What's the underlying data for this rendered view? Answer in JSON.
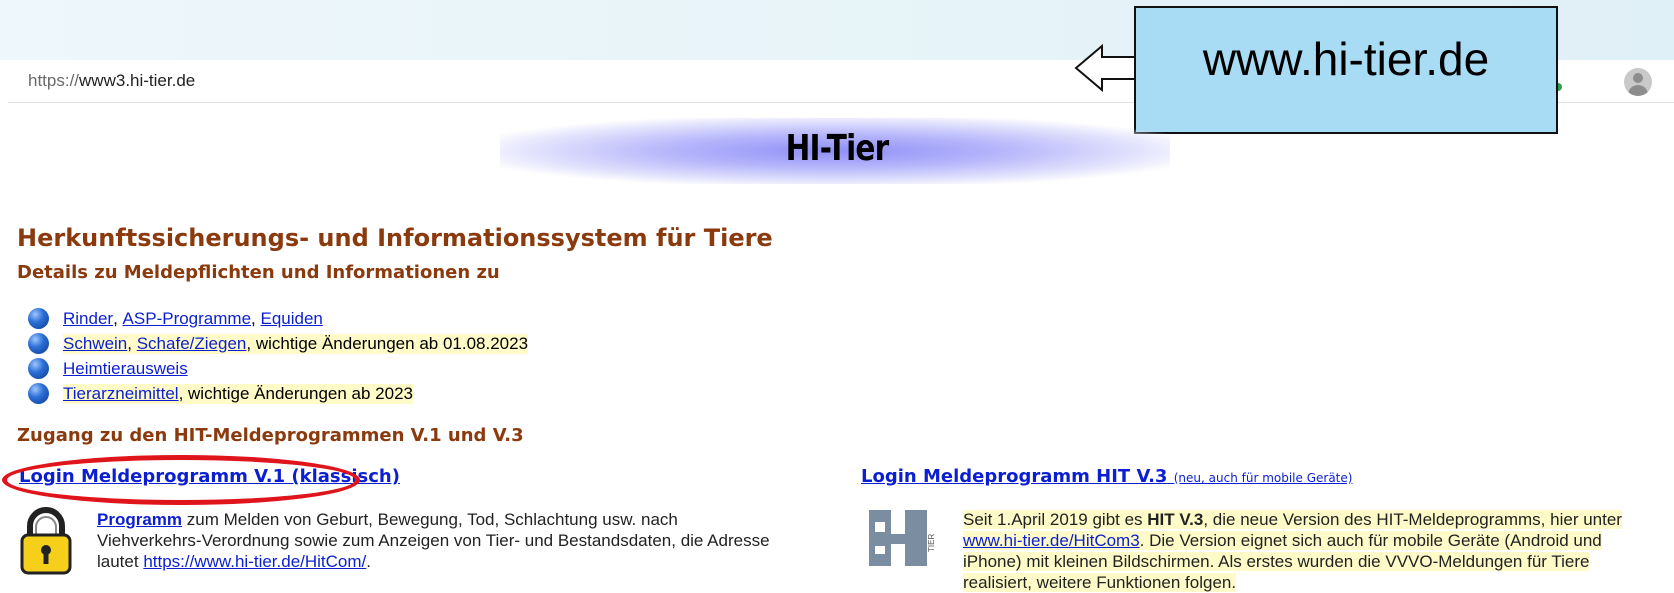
{
  "browser": {
    "url_scheme": "https://",
    "url_host": "www3.hi-tier.de",
    "extension_icon": "heart-monitor-icon",
    "profile_icon": "avatar-icon"
  },
  "callout": {
    "text": "www.hi-tier.de",
    "color": "#a8dcf5"
  },
  "banner": {
    "title": "HI-Tier"
  },
  "heading": "Herkunftssicherungs- und Informationssystem für Tiere",
  "details_heading": "Details zu Meldepflichten und Informationen zu",
  "list": [
    {
      "links": [
        "Rinder",
        "ASP-Programme",
        "Equiden"
      ],
      "note": ""
    },
    {
      "links": [
        "Schwein",
        "Schafe/Ziegen"
      ],
      "note": "wichtige Änderungen ab 01.08.2023"
    },
    {
      "links": [
        "Heimtierausweis"
      ],
      "note": ""
    },
    {
      "links": [
        "Tierarzneimittel"
      ],
      "note": "wichtige Änderungen ab 2023"
    }
  ],
  "access_heading": "Zugang zu den HIT-Meldeprogrammen V.1 und V.3",
  "login_v1": {
    "label": "Login Meldeprogramm V.1 (klassisch)",
    "desc_link": "Programm",
    "desc_line1": " zum Melden von Geburt, Bewegung, Tod, Schlachtung usw. nach",
    "desc_line2": "Viehverkehrs-Verordnung sowie zum Anzeigen von Tier- und Bestandsdaten, die Adresse",
    "desc_line3_prefix": "lautet ",
    "desc_url": "https://www.hi-tier.de/HitCom/",
    "desc_line3_suffix": "."
  },
  "login_v3": {
    "label": "Login Meldeprogramm HIT V.3",
    "small": "(neu, auch für mobile Geräte)",
    "desc_prefix": "Seit 1.April 2019 gibt es ",
    "desc_bold": "HIT V.3",
    "desc_line1_suffix": ", die neue Version des HIT-Meldeprogramms, hier unter",
    "desc_url": "www.hi-tier.de/HitCom3",
    "desc_line2_suffix": ". Die Version eignet sich auch für mobile Geräte (Android und",
    "desc_line3": "iPhone) mit kleinen Bildschirmen. Als erstes wurden die VVVO-Meldungen für Tiere",
    "desc_line4": "realisiert, weitere Funktionen folgen.",
    "logo_text": "TIER"
  },
  "colors": {
    "heading_brown": "#8b3a0e",
    "link_blue": "#0b1fd0",
    "highlight": "#fffbc8",
    "annotation_red": "#e0141b"
  }
}
